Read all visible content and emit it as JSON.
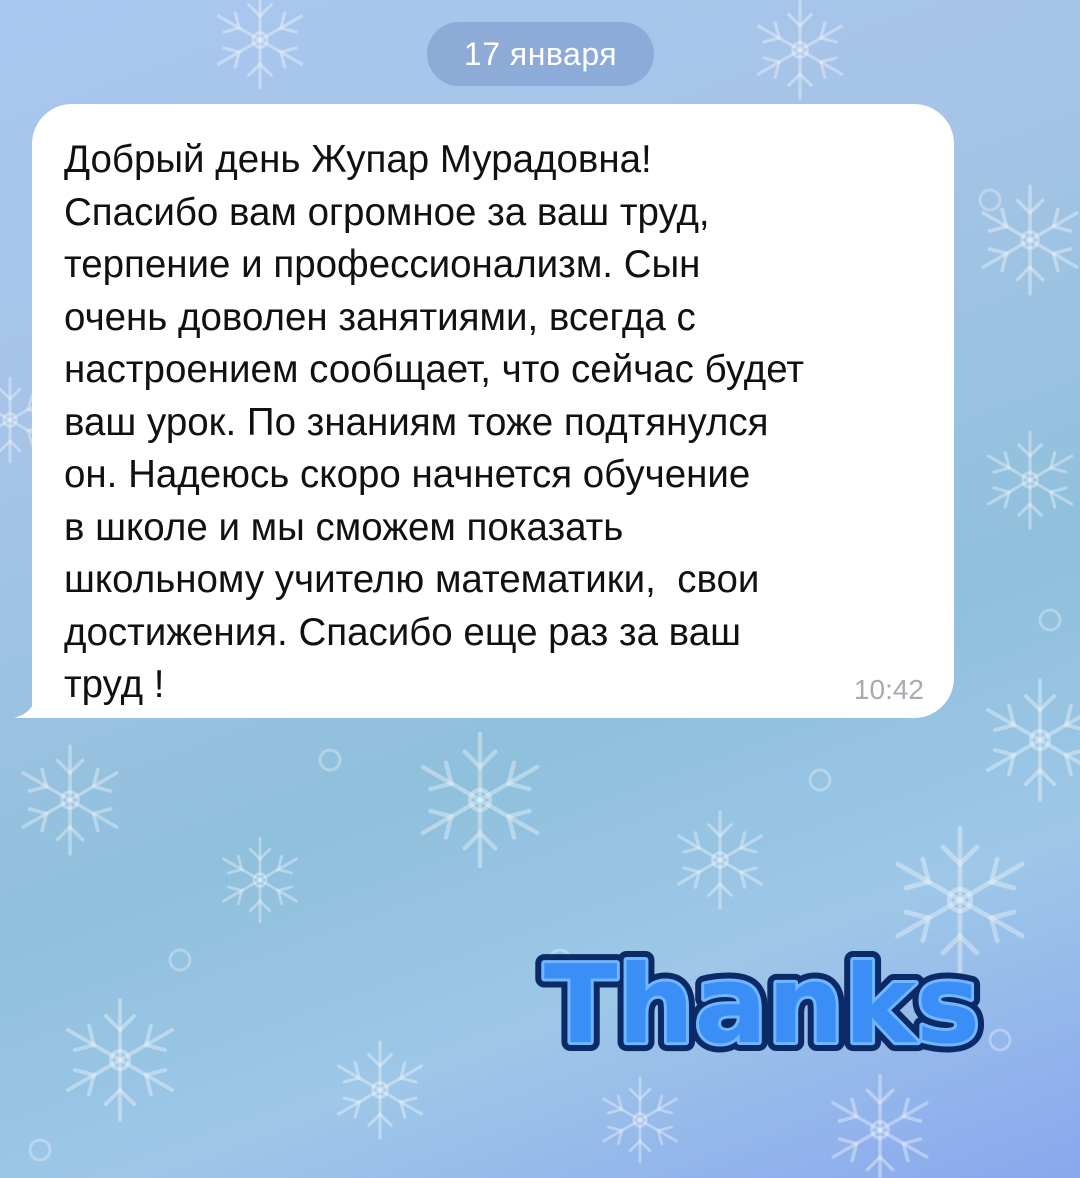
{
  "chat": {
    "date_label": "17 января",
    "message": {
      "text": "Добрый день Жупар Мурадовна!\nСпасибо вам огромное за ваш труд,\nтерпение и профессионализм. Сын\nочень доволен занятиями, всегда с\nнастроением сообщает, что сейчас будет\nваш урок. По знаниям тоже подтянулся\nон. Надеюсь скоро начнется обучение\nв школе и мы сможем показать\nшкольному учителю математики,  свои\nдостижения. Спасибо еще раз за ваш\nтруд !",
      "time": "10:42"
    },
    "sticker": {
      "text": "Thanks",
      "fill_color": "#3b8ef5",
      "outline_color": "#0b2a66"
    },
    "colors": {
      "bubble": "#ffffff",
      "timestamp": "#a6abb2",
      "date_pill": "#7896c8"
    },
    "background_icon": "snowflake-pattern"
  }
}
